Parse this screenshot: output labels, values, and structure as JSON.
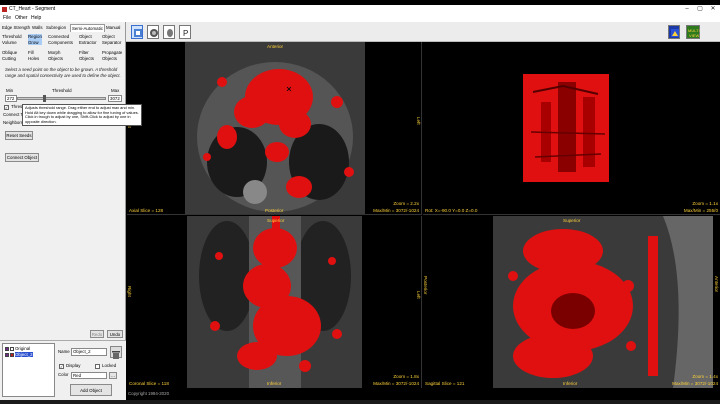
{
  "window": {
    "title": "CT_Heart - Segment",
    "controls": [
      "–",
      "▢",
      "✕"
    ]
  },
  "menu": [
    "File",
    "Other",
    "Help"
  ],
  "toolbar": {
    "left_tools": [
      "segment-tool-icon",
      "mesh-tool-icon",
      "anatomy-tool-icon",
      "data-tool-icon"
    ],
    "right_tools": [
      "view-sample-icon",
      "multi-pbuilding-icon",
      "torso-icon"
    ],
    "right_label_a": "MULTI",
    "right_label_b": "VIEW",
    "torso_icon": "torso-icon"
  },
  "tabs": {
    "items": [
      "Edge Strength",
      "Walls",
      "Subregion",
      "Semi-Automatic",
      "Manual"
    ],
    "active": "Semi-Automatic"
  },
  "tools": {
    "row1": [
      {
        "line1": "Threshold",
        "line2": "Volume"
      },
      {
        "line1": "Region",
        "line2": "Grow",
        "selected": true
      },
      {
        "line1": "Connected",
        "line2": "Components"
      },
      {
        "line1": "Object",
        "line2": "Extractor"
      },
      {
        "line1": "Object",
        "line2": "Separator"
      }
    ],
    "row2": [
      {
        "line1": "Oblique",
        "line2": "Cutting"
      },
      {
        "line1": "Fill",
        "line2": "Holes"
      },
      {
        "line1": "Morph",
        "line2": "Objects"
      },
      {
        "line1": "Filter",
        "line2": "Objects"
      },
      {
        "line1": "Propagate",
        "line2": "Objects"
      }
    ]
  },
  "instructions": "Select a seed point on the object to be grown. A threshold range and spatial connectivity are used to define the object.",
  "threshold": {
    "min_label": "Min",
    "center_label": "Threshold",
    "max_label": "Max",
    "min_value": "272",
    "max_value": "3072",
    "thumb_fraction": 0.3
  },
  "options": {
    "threshold_check_label": "Thresh",
    "connect_label": "Connect T",
    "neighbors_label": "Neighbors"
  },
  "tooltip": "Adjusts threshold range. Drag either end to adjust max and min. Hold Alt key down while dragging to allow for fine tuning of values. Click in trough to adjust by one, Shift-Click to adjust by one in opposite direction.",
  "buttons": {
    "reset_seeds": "Reset Seeds",
    "connect_object": "Connect Object",
    "redo": "Redo",
    "undo": "Undo",
    "add_object": "Add Object"
  },
  "objects": {
    "items": [
      {
        "name": "Original",
        "color": "#c02020",
        "selected": false
      },
      {
        "name": "Object_2",
        "color": "#c02020",
        "selected": true
      }
    ],
    "name_label": "Name",
    "name_value": "Object_2",
    "display_label": "Display",
    "locked_label": "Locked",
    "color_label": "Color",
    "color_value": "Red",
    "trash_icon": "trash-icon"
  },
  "views": {
    "axial": {
      "slice": "Axial Slice = 128",
      "zoom": "Zoom = 2.2x",
      "maxmin": "Max/Min = 3072/-1024",
      "top": "Anterior",
      "bottom": "Posterior",
      "left": "Right",
      "right": "Left"
    },
    "render3d": {
      "rot": "Rot: X=-90.0 Y=0.0 Z=0.0",
      "zoom": "Zoom = 1.1x",
      "maxmin": "Max/Min = 255/0"
    },
    "coronal": {
      "slice": "Coronal Slice = 118",
      "zoom": "Zoom = 1.8x",
      "maxmin": "Max/Min = 3072/-1024",
      "top": "Superior",
      "bottom": "Inferior",
      "left": "Right",
      "right": "Left"
    },
    "sagittal": {
      "slice": "Sagittal Slice = 121",
      "zoom": "Zoom = 1.4x",
      "maxmin": "Max/Min = 3072/-1024",
      "top": "Superior",
      "bottom": "Inferior",
      "left": "Posterior",
      "right": "Anterior"
    }
  },
  "copyright": "Copyright 1994-2020",
  "colors": {
    "segmentation": "#e01010",
    "overlay_text": "#ffd23a",
    "selection": "#2a4fcf"
  }
}
